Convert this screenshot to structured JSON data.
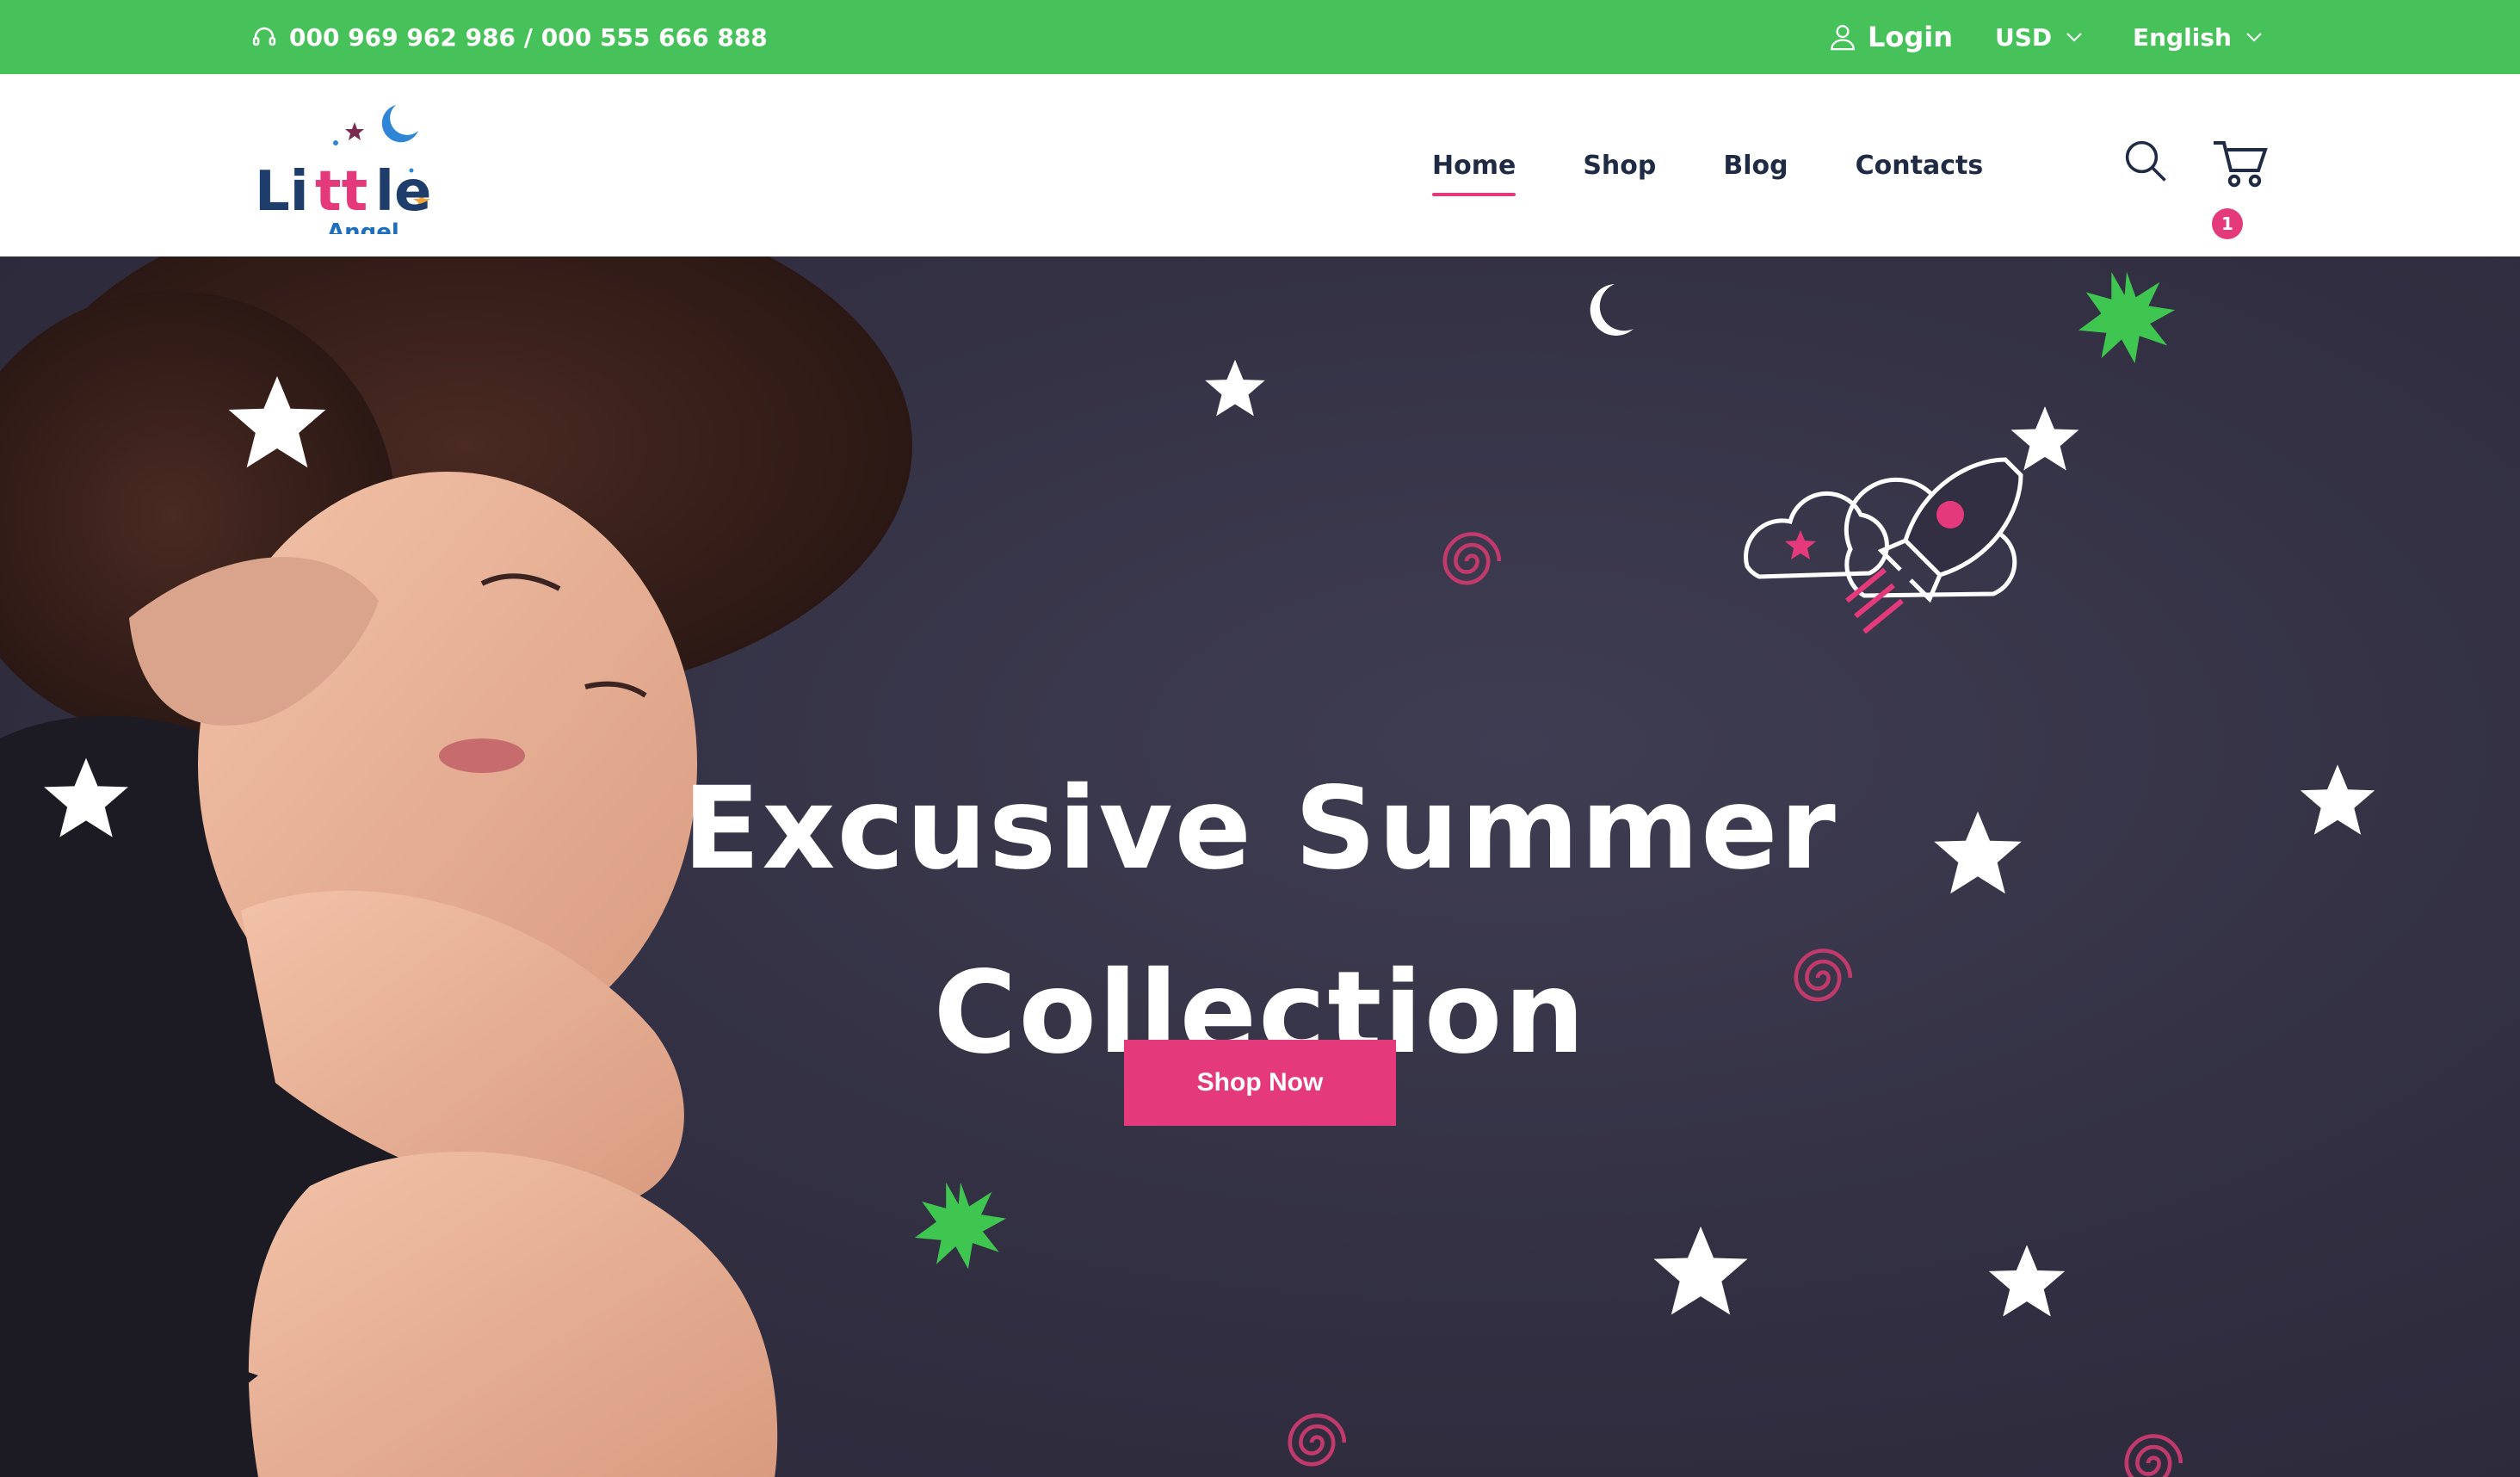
{
  "topbar": {
    "phone": "000 969 962 986 / 000 555 666 888",
    "login_label": "Login",
    "currency": "USD",
    "language": "English",
    "background_color": "#47c25a"
  },
  "header": {
    "logo": {
      "word": "Little",
      "sub": "Angel"
    },
    "nav": [
      {
        "label": "Home",
        "active": true
      },
      {
        "label": "Shop",
        "active": false
      },
      {
        "label": "Blog",
        "active": false
      },
      {
        "label": "Contacts",
        "active": false
      }
    ],
    "cart_count": "1",
    "accent_color": "#e43a7c"
  },
  "hero": {
    "title_line1": "Excusive Summer",
    "title_line2": "Collection",
    "cta_label": "Shop Now",
    "background_color": "#322f42",
    "cta_color": "#e43a7c"
  },
  "icons": [
    "headset-icon",
    "user-icon",
    "chevron-down-icon",
    "search-icon",
    "cart-icon"
  ]
}
